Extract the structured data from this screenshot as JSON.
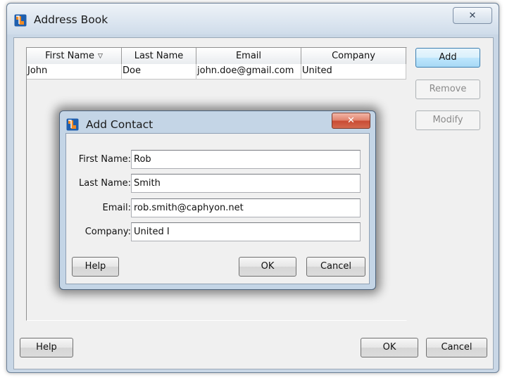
{
  "main_window": {
    "title": "Address Book",
    "close_glyph": "✕",
    "table": {
      "columns": [
        "First Name",
        "Last Name",
        "Email",
        "Company"
      ],
      "sort_icon": "▽",
      "rows": [
        [
          "John",
          "Doe",
          "john.doe@gmail.com",
          "United"
        ]
      ]
    },
    "buttons": {
      "add": "Add",
      "remove": "Remove",
      "modify": "Modify",
      "help": "Help",
      "ok": "OK",
      "cancel": "Cancel"
    }
  },
  "dialog": {
    "title": "Add Contact",
    "close_glyph": "✕",
    "fields": {
      "first_name": {
        "label": "First Name:",
        "value": "Rob"
      },
      "last_name": {
        "label": "Last Name:",
        "value": "Smith"
      },
      "email": {
        "label": "Email:",
        "value": "rob.smith@caphyon.net"
      },
      "company": {
        "label": "Company:",
        "value": "United I"
      }
    },
    "buttons": {
      "help": "Help",
      "ok": "OK",
      "cancel": "Cancel"
    }
  },
  "colors": {
    "window_frame": "#c9d7e6",
    "dialog_frame": "#c4d5e6",
    "close_button_red": "#c94b33",
    "default_button_blue": "#a7d9f5"
  },
  "icons": {
    "app": "app-logo-icon",
    "close": "close-icon",
    "sort": "sort-descending-icon"
  }
}
